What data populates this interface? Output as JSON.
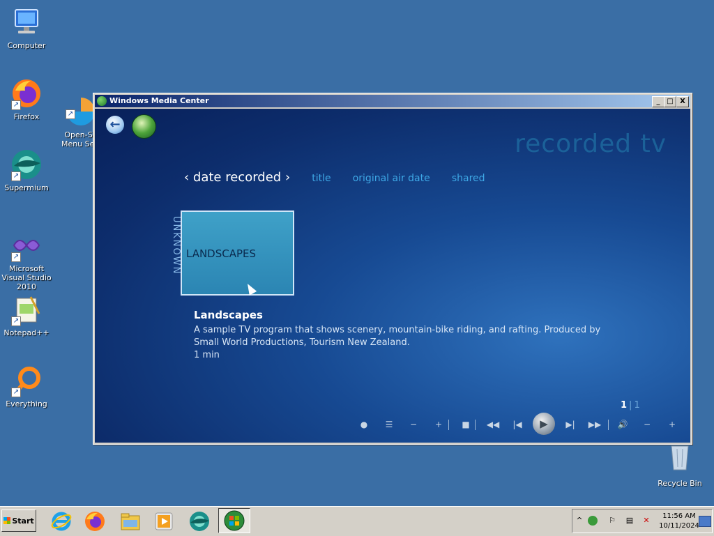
{
  "desktop": {
    "icons": [
      {
        "label": "Computer",
        "icon": "computer-icon"
      },
      {
        "label": "Firefox",
        "icon": "firefox-icon"
      },
      {
        "label": "Open-Sh\nMenu Sett",
        "icon": "open-shell-icon"
      },
      {
        "label": "Supermium",
        "icon": "supermium-icon"
      },
      {
        "label": "Microsoft Visual Studio 2010",
        "icon": "visual-studio-icon"
      },
      {
        "label": "Notepad++",
        "icon": "notepadpp-icon"
      },
      {
        "label": "Everything",
        "icon": "everything-icon"
      },
      {
        "label": "Recycle Bin",
        "icon": "recycle-bin-icon"
      }
    ]
  },
  "window": {
    "title": "Windows Media Center",
    "controls": {
      "minimize": "_",
      "maximize": "□",
      "close": "X"
    }
  },
  "wmc": {
    "page_title": "recorded tv",
    "sort_active": "‹ date recorded ›",
    "sort_options": [
      "title",
      "original air date",
      "shared"
    ],
    "group_label": "UNKNOWN",
    "tile_label": "LANDSCAPES",
    "detail": {
      "title": "Landscapes",
      "description": "A sample TV program that shows scenery, mountain-bike riding, and rafting. Produced by Small World Productions, Tourism New Zealand.",
      "duration": "1 min"
    },
    "pager": {
      "current": "1",
      "separator": "|",
      "total": "1"
    },
    "transport": {
      "record": "●",
      "guide": "☰",
      "minus": "−",
      "plus": "+",
      "stop": "■",
      "rewind": "◀◀",
      "skip_back": "|◀",
      "play": "▶",
      "skip_forward": "▶|",
      "fast_forward": "▶▶",
      "volume": "🔊",
      "vol_down": "−",
      "vol_up": "+"
    }
  },
  "taskbar": {
    "start_label": "Start",
    "apps": [
      "internet-explorer-icon",
      "firefox-icon",
      "file-explorer-icon",
      "media-player-icon",
      "supermium-icon",
      "media-center-icon"
    ],
    "tray": {
      "time": "11:56 AM",
      "date": "10/11/2024",
      "expand": "^"
    }
  }
}
